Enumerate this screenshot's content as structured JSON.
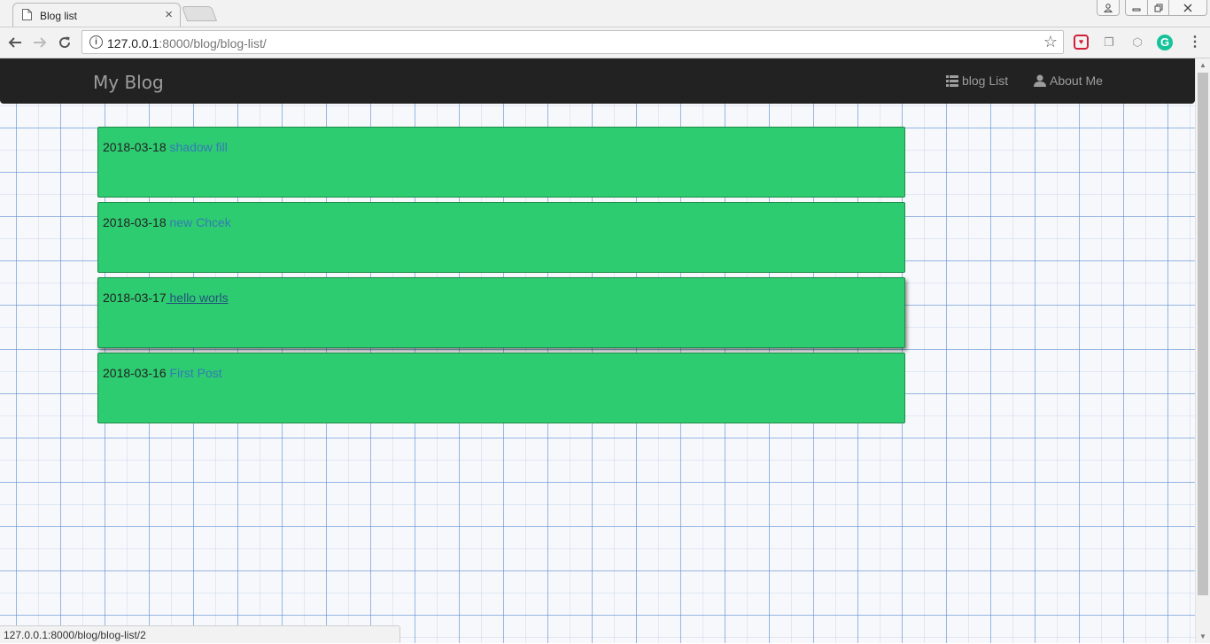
{
  "browser": {
    "tab_title": "Blog list",
    "tab_close": "×",
    "url_host": "127.0.0.1",
    "url_rest": ":8000/blog/blog-list/",
    "status_url": "127.0.0.1:8000/blog/blog-list/2"
  },
  "navbar": {
    "brand": "My Blog",
    "links": [
      {
        "label": "blog List",
        "icon": "list-icon"
      },
      {
        "label": "About Me",
        "icon": "user-icon"
      }
    ]
  },
  "posts": [
    {
      "date": "2018-03-18",
      "title": "shadow fill"
    },
    {
      "date": "2018-03-18",
      "title": "new Chcek"
    },
    {
      "date": "2018-03-17",
      "title": "hello worls",
      "state": "hovered"
    },
    {
      "date": "2018-03-16",
      "title": "First Post"
    }
  ],
  "colors": {
    "card": "#2ecc71",
    "navbar": "#222222",
    "link": "#337ab7"
  }
}
